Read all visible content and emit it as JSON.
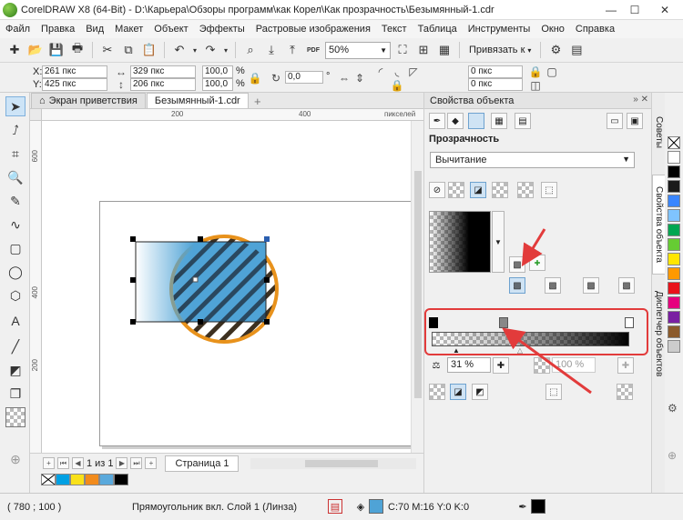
{
  "window": {
    "title": "CorelDRAW X8 (64-Bit) - D:\\Карьера\\Обзоры программ\\как Корел\\Как прозрачность\\Безымянный-1.cdr",
    "minimize": "—",
    "maximize": "☐",
    "close": "✕"
  },
  "menu": [
    "Файл",
    "Правка",
    "Вид",
    "Макет",
    "Объект",
    "Эффекты",
    "Растровые изображения",
    "Текст",
    "Таблица",
    "Инструменты",
    "Окно",
    "Справка"
  ],
  "toolbar": {
    "zoom": "50%",
    "snap_label": "Привязать к",
    "pdf_label": "PDF"
  },
  "propbar": {
    "x_label": "X:",
    "x_value": "261 пкс",
    "y_label": "Y:",
    "y_value": "425 пкс",
    "width_value": "329 пкс",
    "height_value": "206 пкс",
    "scale_w": "100,0",
    "scale_h": "100,0",
    "percent": "%",
    "rotation": "0,0",
    "rotation_unit": "°",
    "corner_1": "0 пкс",
    "corner_2": "0 пкс"
  },
  "doc_tabs": [
    {
      "label": "Экран приветствия",
      "active": false
    },
    {
      "label": "Безымянный-1.cdr",
      "active": true
    }
  ],
  "ruler": {
    "h_ticks": [
      "200",
      "400"
    ],
    "h_unit": "пикселей",
    "v_ticks": [
      "600",
      "400",
      "200"
    ]
  },
  "page_nav": {
    "current": "1",
    "of": "из",
    "total": "1",
    "page_tab": "Страница 1"
  },
  "doc_palette": [
    "#00a0e3",
    "#f9e11a",
    "#f28b1c",
    "#5aa9dc",
    "#000000"
  ],
  "docker": {
    "title": "Свойства объекта",
    "section": "Прозрачность",
    "merge_mode": "Вычитание",
    "start_transparency": "31 %",
    "end_transparency": "100 %"
  },
  "vertical_tabs": [
    "Советы",
    "Свойства объекта",
    "Диспетчер объектов"
  ],
  "palette": [
    "#ffffff",
    "#000000",
    "#1a1a1a",
    "#3a86ff",
    "#7fc4ff",
    "#00a651",
    "#66cc33",
    "#ffe600",
    "#ff9900",
    "#e9131b",
    "#e6007e",
    "#7a1fa2",
    "#8b5a2b",
    "#cccccc"
  ],
  "statusbar": {
    "coords": "( 780 ; 100 )",
    "object_info": "Прямоугольник вкл. Слой 1  (Линза)",
    "fill_info": "C:70 M:16 Y:0 K:0",
    "outline_color": "#000000",
    "fill_color": "#4fa3d6"
  },
  "colors": {
    "circle_outline": "#e8921c",
    "rect_fill": "#4fa3d6",
    "annotation": "#e23b3b"
  }
}
